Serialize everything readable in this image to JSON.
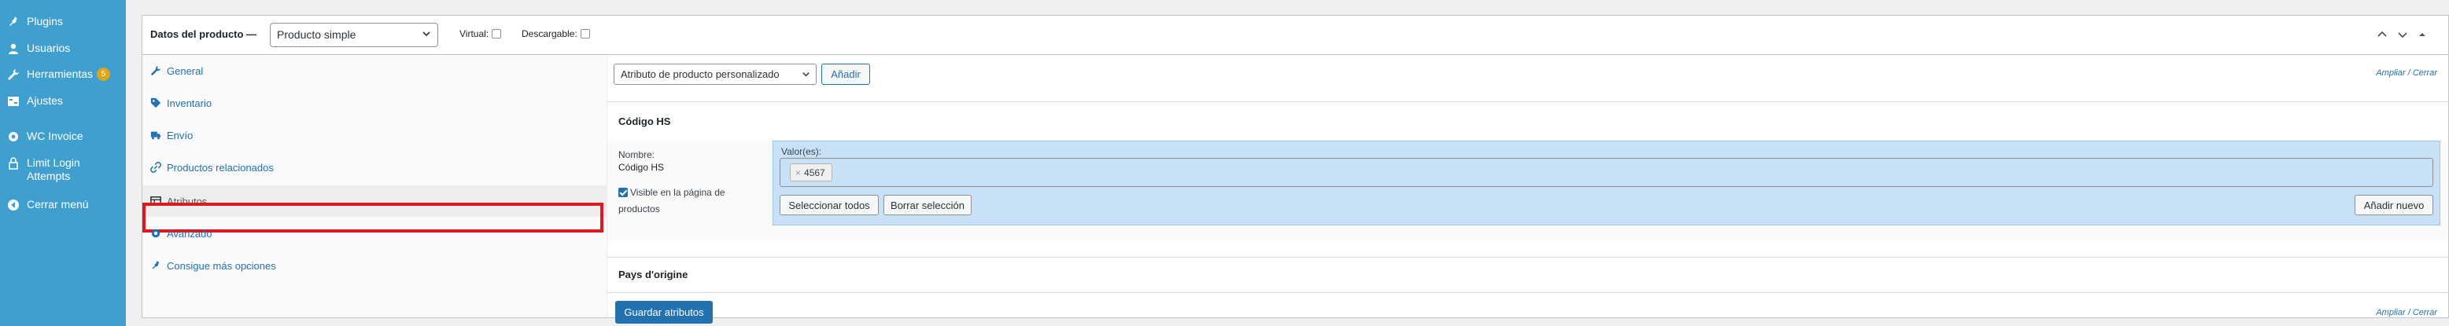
{
  "sidebar": {
    "items": [
      {
        "label": "Plugins",
        "icon": "plugin-icon"
      },
      {
        "label": "Usuarios",
        "icon": "users-icon"
      },
      {
        "label": "Herramientas",
        "icon": "wrench-icon",
        "badge": "5"
      },
      {
        "label": "Ajustes",
        "icon": "settings-icon"
      },
      {
        "label": "WC Invoice",
        "icon": "gear-icon"
      },
      {
        "label": "Limit Login Attempts",
        "icon": "lock-icon"
      },
      {
        "label": "Cerrar menú",
        "icon": "collapse-icon"
      }
    ],
    "background": "#3f9fcf"
  },
  "product_data": {
    "title": "Datos del producto —",
    "product_type": "Producto simple",
    "virtual_label": "Virtual:",
    "downloadable_label": "Descargable:"
  },
  "tabs": [
    {
      "label": "General",
      "icon": "wrench-icon",
      "active": false
    },
    {
      "label": "Inventario",
      "icon": "tag-icon",
      "active": false
    },
    {
      "label": "Envío",
      "icon": "truck-icon",
      "active": false
    },
    {
      "label": "Productos relacionados",
      "icon": "link-icon",
      "active": false
    },
    {
      "label": "Atributos",
      "icon": "table-icon",
      "active": true
    },
    {
      "label": "Avanzado",
      "icon": "gear-icon",
      "active": false
    },
    {
      "label": "Consigue más opciones",
      "icon": "plugin-icon",
      "active": false
    }
  ],
  "attributes": {
    "select_value": "Atributo de producto personalizado",
    "add_button": "Añadir",
    "expand": "Ampliar",
    "slash": "/",
    "close": "Cerrar",
    "items": [
      {
        "title": "Código HS",
        "name_label": "Nombre:",
        "name_value": "Código HS",
        "visible_label": "Visible en la página de productos",
        "visible_checked": true,
        "values_label": "Valor(es):",
        "values": [
          "4567"
        ],
        "select_all": "Seleccionar todos",
        "clear_selection": "Borrar selección",
        "add_new": "Añadir nuevo"
      },
      {
        "title": "Pays d'origine"
      }
    ],
    "save_button": "Guardar atributos"
  },
  "colors": {
    "accent": "#2271b1",
    "highlight_border": "#e1171e",
    "values_bg": "#c9e1f6",
    "badge": "#dba617"
  }
}
